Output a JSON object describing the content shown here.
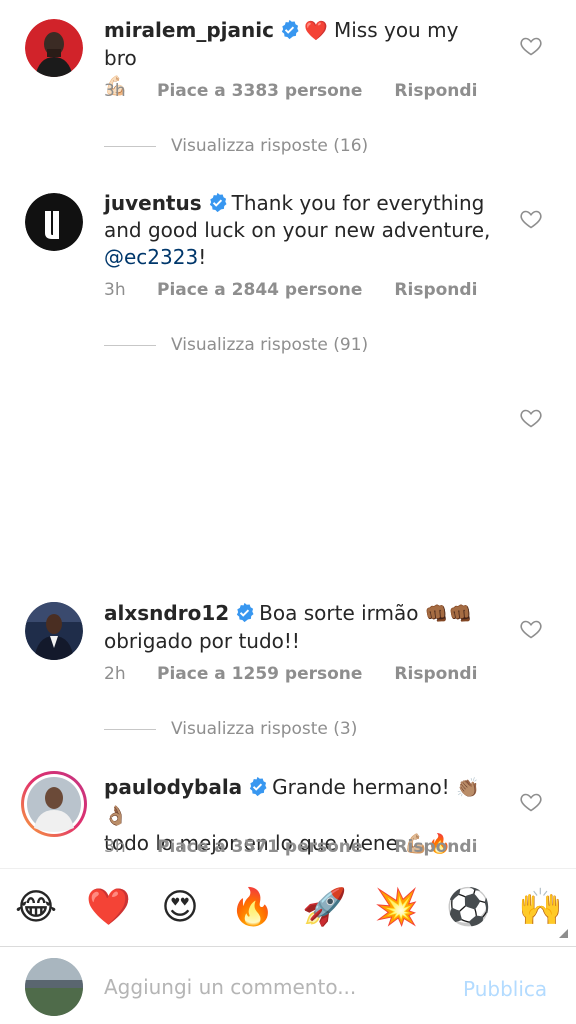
{
  "comments": [
    {
      "username": "miralem_pjanic",
      "text": "Miss you my bro",
      "lead_emoji": "❤️",
      "trail_emoji": "💪🏻",
      "time": "3h",
      "likes": "Piace a 3383 persone",
      "reply": "Rispondi",
      "view_replies": "Visualizza risposte (16)"
    },
    {
      "username": "juventus",
      "text_line1": "Thank you for everything",
      "text_line2": "and good luck on your new adventure,",
      "mention": "@ec2323",
      "trail": "!",
      "time": "3h",
      "likes": "Piace a 2844 persone",
      "reply": "Rispondi",
      "view_replies": "Visualizza risposte (91)"
    },
    {
      "username": "alxsndro12",
      "text": "Boa sorte irmão",
      "emoji": "👊🏾👊🏾",
      "text_line2": "obrigado por tudo!!",
      "time": "2h",
      "likes": "Piace a 1259 persone",
      "reply": "Rispondi",
      "view_replies": "Visualizza risposte (3)"
    },
    {
      "username": "paulodybala",
      "text": "Grande hermano!",
      "emoji": "👏🏽👌🏽",
      "text_line2": "todo lo mejor en lo que viene",
      "emoji2": "💪🏼🔥",
      "time": "3h",
      "likes": "Piace a 3571 persone",
      "reply": "Rispondi"
    }
  ],
  "emoji_bar": [
    "😂",
    "❤️",
    "😍",
    "🔥",
    "🚀",
    "💥",
    "⚽",
    "🙌"
  ],
  "composer": {
    "placeholder": "Aggiungi un commento...",
    "publish": "Pubblica"
  },
  "colors": {
    "verified": "#3897f0",
    "muted": "#8e8e8e",
    "mention": "#00376b",
    "publish_disabled": "#b3dbff"
  }
}
